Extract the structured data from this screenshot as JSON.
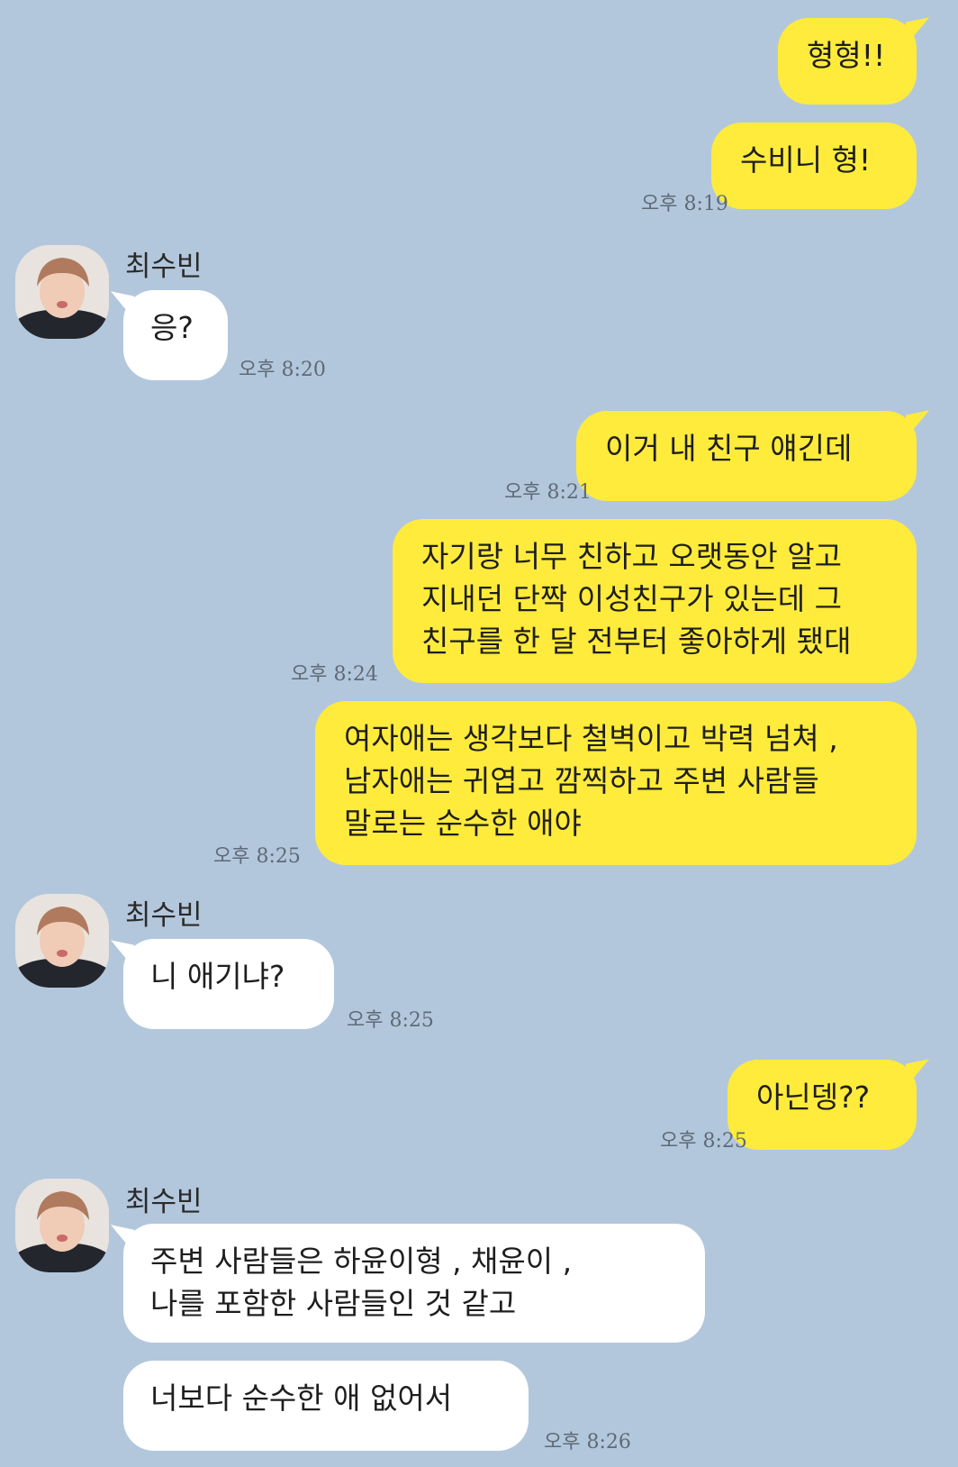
{
  "chat": {
    "contact_name": "최수빈",
    "colors": {
      "background": "#b3c7dc",
      "my_bubble": "#ffeb3b",
      "their_bubble": "#ffffff"
    },
    "messages": [
      {
        "text": "형형!!",
        "sender": "me"
      },
      {
        "text": "수비니 형!",
        "sender": "me",
        "time": "오후 8:19"
      },
      {
        "text": "응?",
        "sender": "them",
        "name": "최수빈",
        "time": "오후 8:20"
      },
      {
        "text": "이거 내 친구 얘긴데",
        "sender": "me",
        "time": "오후 8:21"
      },
      {
        "text": "자기랑 너무 친하고 오랫동안 알고\n지내던 단짝 이성친구가 있는데 그\n친구를 한 달 전부터 좋아하게 됐대",
        "sender": "me",
        "time": "오후 8:24"
      },
      {
        "text": "여자애는 생각보다 철벽이고 박력 넘쳐 ,\n남자애는 귀엽고 깜찍하고 주변 사람들\n말로는 순수한 애야",
        "sender": "me",
        "time": "오후 8:25"
      },
      {
        "text": "니 애기냐?",
        "sender": "them",
        "name": "최수빈",
        "time": "오후 8:25"
      },
      {
        "text": "아닌뎅??",
        "sender": "me",
        "time": "오후 8:25"
      },
      {
        "text": "주변 사람들은 하윤이형 , 채윤이 ,\n나를 포함한 사람들인 것 같고",
        "sender": "them",
        "name": "최수빈"
      },
      {
        "text": "너보다 순수한 애 없어서",
        "sender": "them",
        "time": "오후 8:26"
      }
    ]
  },
  "icons": {
    "avatar": "profile-photo"
  }
}
